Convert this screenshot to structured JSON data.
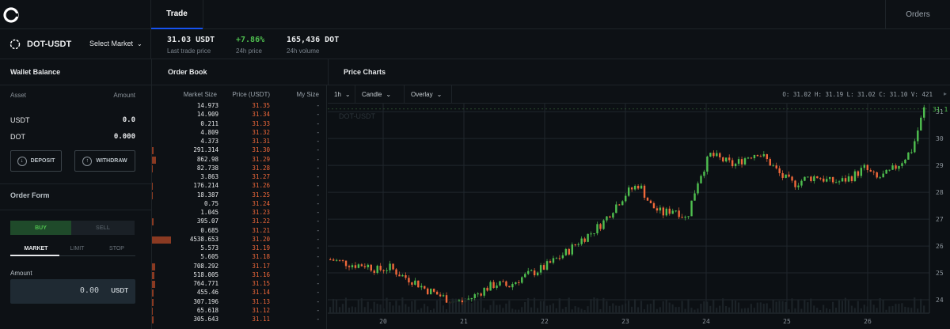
{
  "nav": {
    "trade_tab": "Trade",
    "orders_tab": "Orders"
  },
  "ticker": {
    "pair": "DOT-USDT",
    "select_market": "Select Market",
    "last_price": "31.03 USDT",
    "last_price_label": "Last trade price",
    "change": "+7.86%",
    "change_label": "24h price",
    "volume": "165,436 DOT",
    "volume_label": "24h volume"
  },
  "wallet": {
    "title": "Wallet Balance",
    "col_asset": "Asset",
    "col_amount": "Amount",
    "rows": [
      {
        "asset": "USDT",
        "amount": "0.0"
      },
      {
        "asset": "DOT",
        "amount": "0.000"
      }
    ],
    "deposit": "DEPOSIT",
    "withdraw": "WITHDRAW"
  },
  "order_form": {
    "title": "Order Form",
    "buy": "BUY",
    "sell": "SELL",
    "types": [
      "MARKET",
      "LIMIT",
      "STOP"
    ],
    "amount_label": "Amount",
    "amount_value": "0.00",
    "amount_unit": "USDT"
  },
  "order_book": {
    "title": "Order Book",
    "col_size": "Market Size",
    "col_price": "Price (USDT)",
    "col_my": "My Size",
    "rows": [
      {
        "size": "14.973",
        "price": "31.35",
        "my": "-",
        "depth": 0.0
      },
      {
        "size": "14.909",
        "price": "31.34",
        "my": "-",
        "depth": 0.0
      },
      {
        "size": "0.211",
        "price": "31.33",
        "my": "-",
        "depth": 0.0
      },
      {
        "size": "4.809",
        "price": "31.32",
        "my": "-",
        "depth": 0.0
      },
      {
        "size": "4.373",
        "price": "31.31",
        "my": "-",
        "depth": 0.0
      },
      {
        "size": "291.314",
        "price": "31.30",
        "my": "-",
        "depth": 0.064
      },
      {
        "size": "862.98",
        "price": "31.29",
        "my": "-",
        "depth": 0.19
      },
      {
        "size": "82.738",
        "price": "31.28",
        "my": "-",
        "depth": 0.018
      },
      {
        "size": "3.863",
        "price": "31.27",
        "my": "-",
        "depth": 0.0
      },
      {
        "size": "176.214",
        "price": "31.26",
        "my": "-",
        "depth": 0.039
      },
      {
        "size": "18.387",
        "price": "31.25",
        "my": "-",
        "depth": 0.004
      },
      {
        "size": "0.75",
        "price": "31.24",
        "my": "-",
        "depth": 0.0
      },
      {
        "size": "1.045",
        "price": "31.23",
        "my": "-",
        "depth": 0.0
      },
      {
        "size": "395.07",
        "price": "31.22",
        "my": "-",
        "depth": 0.087
      },
      {
        "size": "0.685",
        "price": "31.21",
        "my": "-",
        "depth": 0.0
      },
      {
        "size": "4538.653",
        "price": "31.20",
        "my": "-",
        "depth": 1.0
      },
      {
        "size": "5.573",
        "price": "31.19",
        "my": "-",
        "depth": 0.0
      },
      {
        "size": "5.605",
        "price": "31.18",
        "my": "-",
        "depth": 0.0
      },
      {
        "size": "708.292",
        "price": "31.17",
        "my": "-",
        "depth": 0.156
      },
      {
        "size": "518.005",
        "price": "31.16",
        "my": "-",
        "depth": 0.114
      },
      {
        "size": "764.771",
        "price": "31.15",
        "my": "-",
        "depth": 0.168
      },
      {
        "size": "455.46",
        "price": "31.14",
        "my": "-",
        "depth": 0.1
      },
      {
        "size": "307.196",
        "price": "31.13",
        "my": "-",
        "depth": 0.068
      },
      {
        "size": "65.618",
        "price": "31.12",
        "my": "-",
        "depth": 0.014
      },
      {
        "size": "305.643",
        "price": "31.11",
        "my": "-",
        "depth": 0.067
      }
    ]
  },
  "price_chart": {
    "title": "Price Charts",
    "interval": "1h",
    "chart_style": "Candle",
    "overlay": "Overlay",
    "ohlc": "O: 31.02  H: 31.19  L: 31.02  C: 31.10  V:    421",
    "watermark": "DOT-USDT",
    "last_label": "31.1",
    "colors": {
      "up": "#4fbf4f",
      "down": "#f0683a",
      "grid": "#1f262c"
    }
  },
  "chart_data": {
    "type": "line",
    "x_ticks": [
      "20",
      "21",
      "22",
      "23",
      "24",
      "25",
      "26"
    ],
    "y_ticks": [
      "24",
      "25",
      "26",
      "27",
      "28",
      "29",
      "30",
      "31"
    ],
    "ylim": [
      23.5,
      31.3
    ],
    "series": [
      {
        "values": [
          25.5,
          25.4,
          25.3,
          25.3,
          25.1,
          25.2,
          24.9,
          24.7,
          24.4,
          24.2,
          24.0,
          23.9,
          24.1,
          24.4,
          24.6,
          24.5,
          24.8,
          25.0,
          25.2,
          25.5,
          25.8,
          26.2,
          26.5,
          26.9,
          27.5,
          28.0,
          28.3,
          27.5,
          27.2,
          27.4,
          27.0,
          28.5,
          29.4,
          29.2,
          29.0,
          29.3,
          29.5,
          29.1,
          28.6,
          28.3,
          28.5,
          28.6,
          28.4,
          28.4,
          28.6,
          28.9,
          28.5,
          28.7,
          29.1,
          29.6,
          31.1
        ]
      }
    ]
  }
}
